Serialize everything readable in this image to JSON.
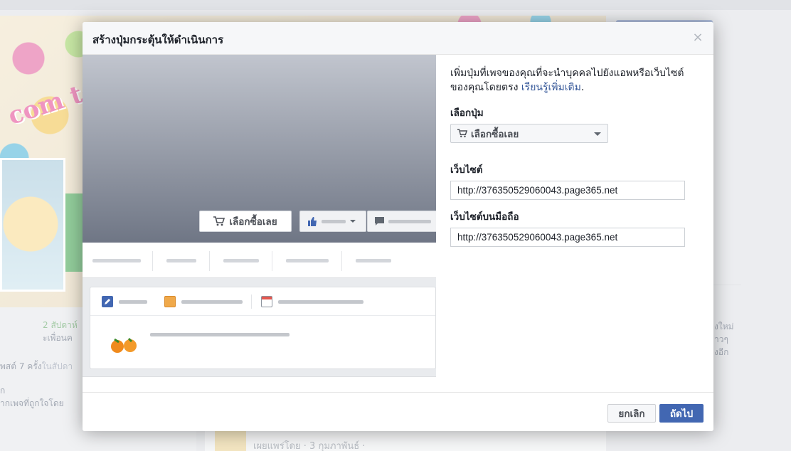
{
  "background": {
    "cover_welcome_text": "com to me",
    "left_line1": "2 สัปดาห์",
    "left_line2": "ะเพื่อนค",
    "left_line3_prefix": "พสต์ 7 ครั้ง",
    "left_line3_suffix": "ในสัปดา",
    "left_line4": "ก",
    "left_line5": "ากเพจที่ถูกใจโดย",
    "feed_text": "เผยแพร่โดย · 3 กุมภาพันธ์ ·",
    "right_line1": "งใหม่",
    "right_line2": "าวๆ",
    "right_line3": "งอีก"
  },
  "dialog": {
    "title": "สร้างปุ่มกระตุ้นให้ดำเนินการ",
    "close_glyph": "×"
  },
  "preview": {
    "cta_label": "เลือกซื้อเลย"
  },
  "form": {
    "description": "เพิ่มปุ่มที่เพจของคุณที่จะนำบุคคลไปยังแอพหรือเว็บไซต์ของคุณโดยตรง",
    "learn_more": "เรียนรู้เพิ่มเติม",
    "period": ".",
    "select_label": "เลือกปุ่ม",
    "select_value": "เลือกซื้อเลย",
    "website_label": "เว็บไซต์",
    "website_value": "http://376350529060043.page365.net",
    "mobile_label": "เว็บไซต์บนมือถือ",
    "mobile_value": "http://376350529060043.page365.net"
  },
  "footer": {
    "cancel_label": "ยกเลิก",
    "next_label": "ถัดไป"
  },
  "colors": {
    "primary": "#4267b2",
    "link": "#365899"
  },
  "icons": {
    "cta": "cart-icon",
    "like": "thumbs-up-icon",
    "message": "speech-bubble-icon",
    "close": "close-icon"
  }
}
